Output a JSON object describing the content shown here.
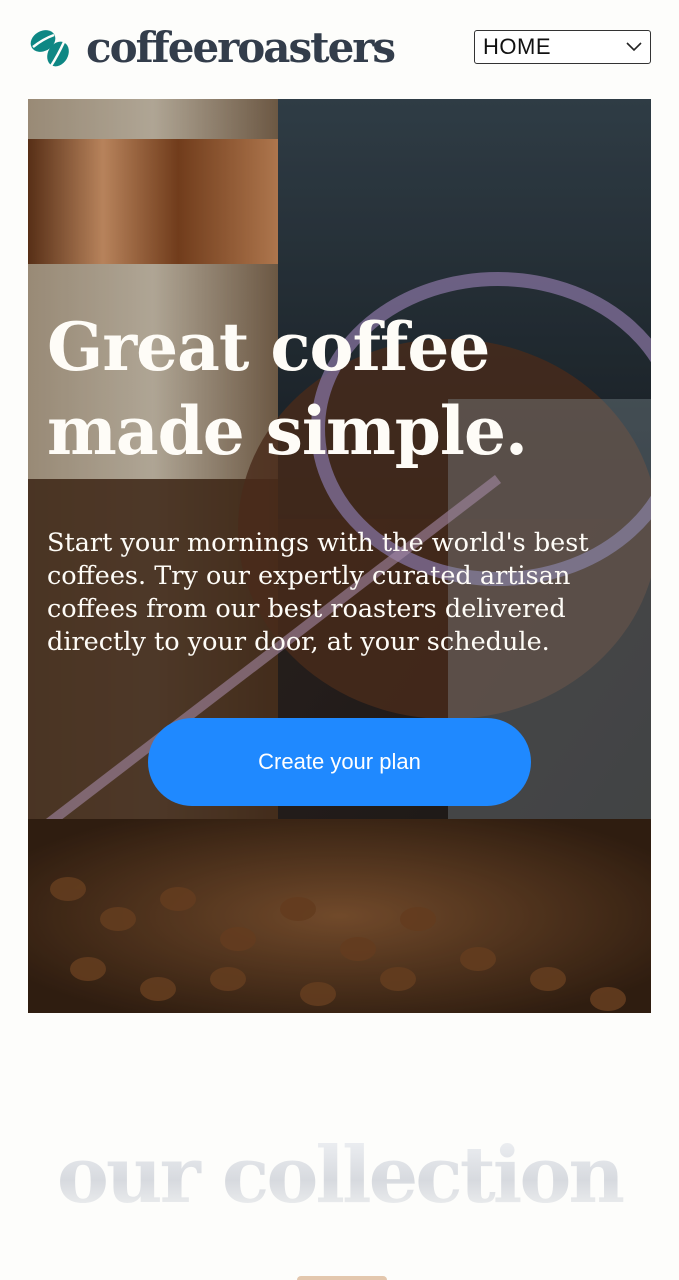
{
  "header": {
    "logo_text": "coffeeroasters",
    "nav_select": {
      "selected": "HOME"
    }
  },
  "hero": {
    "title_line1": "Great coffee",
    "title_line2": "made simple.",
    "description": "Start your mornings with the world's best coffees. Try our expertly curated artisan coffees from our best roasters delivered directly to your door, at your schedule.",
    "cta_label": "Create your plan"
  },
  "collection": {
    "heading": "our collection"
  },
  "colors": {
    "accent": "#1f89ff",
    "logo_teal": "#0e8784",
    "logo_text": "#333d4b",
    "hero_text": "#fefcf7"
  },
  "icons": {
    "logo": "coffee-bean-icon",
    "dropdown": "chevron-down-icon"
  }
}
